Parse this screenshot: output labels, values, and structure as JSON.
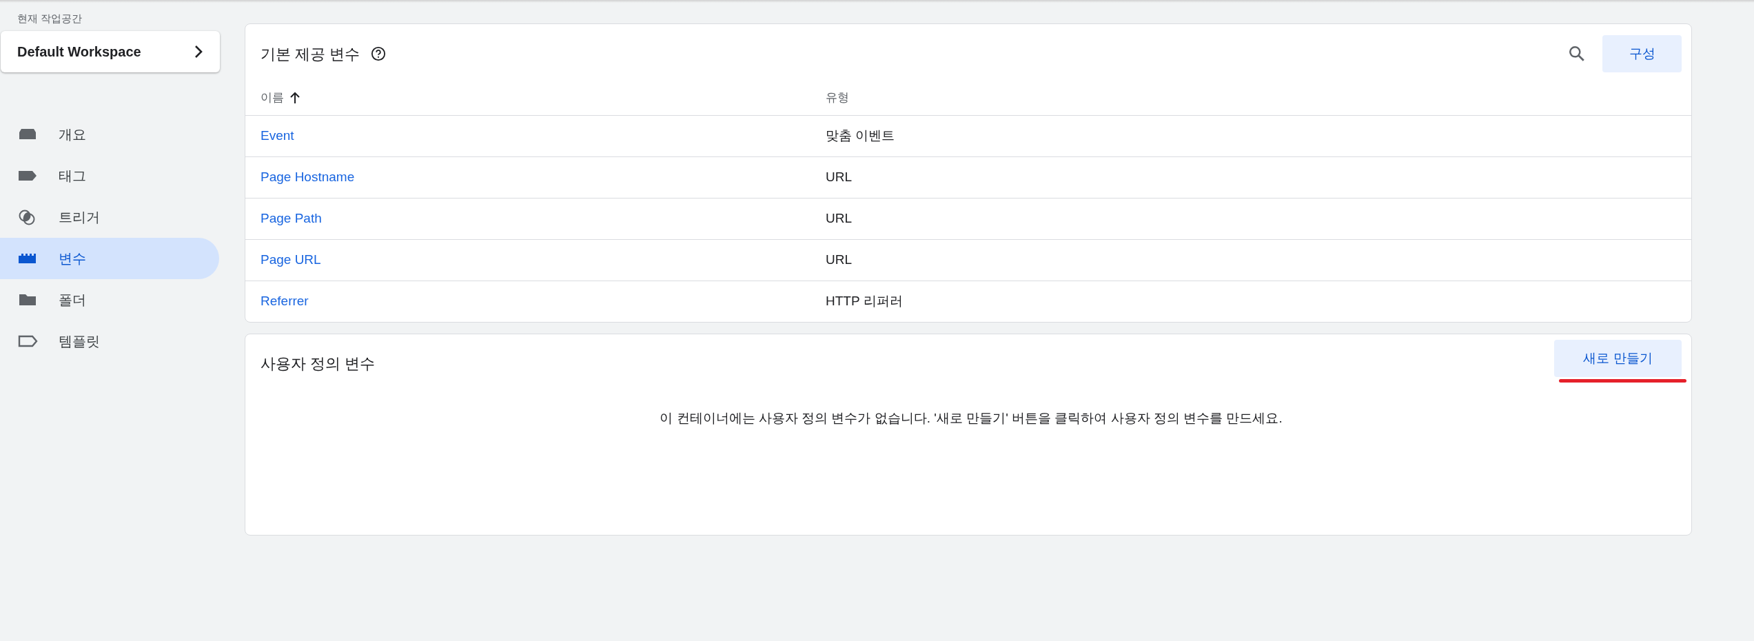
{
  "sidebar": {
    "workspace_label": "현재 작업공간",
    "workspace": "Default Workspace",
    "items": [
      {
        "label": "개요",
        "kind": "overview",
        "selected": false
      },
      {
        "label": "태그",
        "kind": "tag",
        "selected": false
      },
      {
        "label": "트리거",
        "kind": "trigger",
        "selected": false
      },
      {
        "label": "변수",
        "kind": "variable",
        "selected": true
      },
      {
        "label": "폴더",
        "kind": "folder",
        "selected": false
      },
      {
        "label": "템플릿",
        "kind": "template",
        "selected": false
      }
    ]
  },
  "builtin_variables": {
    "title": "기본 제공 변수",
    "button": "구성",
    "columns": [
      {
        "label": "이름",
        "sorted": true
      },
      {
        "label": "유형",
        "sorted": false
      }
    ],
    "rows": [
      {
        "name": "Event",
        "type": "맞춤 이벤트"
      },
      {
        "name": "Page Hostname",
        "type": "URL"
      },
      {
        "name": "Page Path",
        "type": "URL"
      },
      {
        "name": "Page URL",
        "type": "URL"
      },
      {
        "name": "Referrer",
        "type": "HTTP 리퍼러"
      }
    ]
  },
  "user_variables": {
    "title": "사용자 정의 변수",
    "button": "새로 만들기",
    "empty_message": "이 컨테이너에는 사용자 정의 변수가 없습니다. '새로 만들기' 버튼을 클릭하여 사용자 정의 변수를 만드세요."
  }
}
